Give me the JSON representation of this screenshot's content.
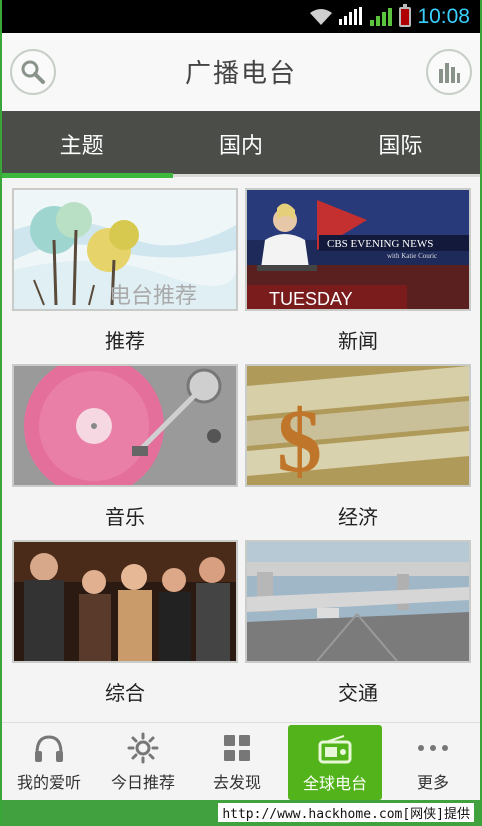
{
  "statusbar": {
    "time": "10:08"
  },
  "app": {
    "title": "广播电台"
  },
  "tabs": [
    {
      "label": "主题",
      "active": true
    },
    {
      "label": "国内",
      "active": false
    },
    {
      "label": "国际",
      "active": false
    }
  ],
  "categories": [
    {
      "label": "推荐",
      "image_caption": "电台推荐"
    },
    {
      "label": "新闻",
      "image_caption": "CBS EVENING NEWS",
      "image_caption2": "with Katie Couric",
      "image_caption3": "TUESDAY"
    },
    {
      "label": "音乐"
    },
    {
      "label": "经济"
    },
    {
      "label": "综合"
    },
    {
      "label": "交通"
    }
  ],
  "bottom_nav": [
    {
      "label": "我的爱听",
      "icon": "headphones-icon"
    },
    {
      "label": "今日推荐",
      "icon": "sun-icon"
    },
    {
      "label": "去发现",
      "icon": "grid-icon"
    },
    {
      "label": "全球电台",
      "icon": "radio-icon",
      "active": true
    },
    {
      "label": "更多",
      "icon": "more-dots-icon"
    }
  ],
  "footer": {
    "watermark": "http://www.hackhome.com[网侠]提供"
  },
  "colors": {
    "accent": "#52b31a",
    "tabbar": "#4a4d48",
    "indicator": "#3db73d",
    "time": "#3ad0ff"
  }
}
